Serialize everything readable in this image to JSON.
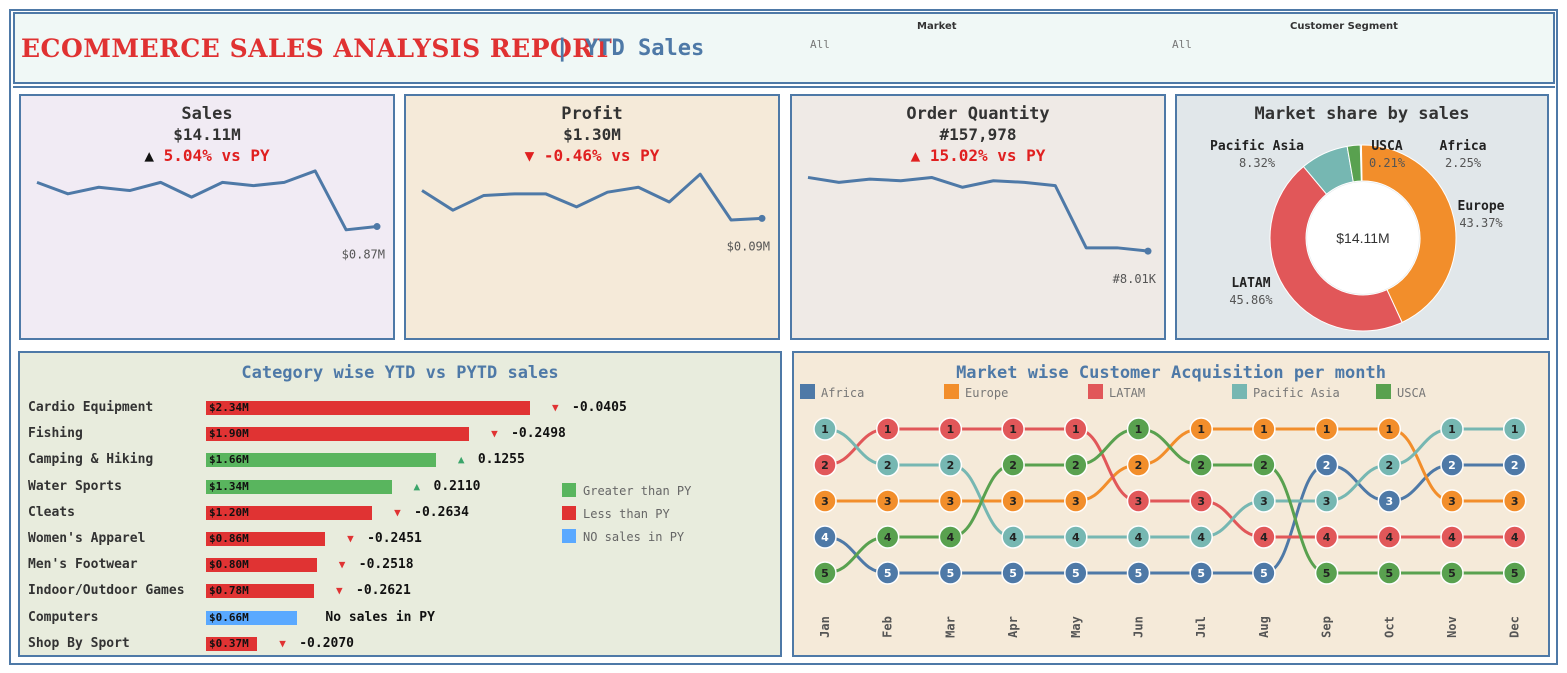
{
  "header": {
    "title": "ECOMMERCE SALES ANALYSIS REPORT",
    "separator": "|",
    "subtitle": "YTD Sales",
    "filters": [
      {
        "label": "Market",
        "value": "All"
      },
      {
        "label": "Customer Segment",
        "value": "All"
      }
    ]
  },
  "kpis": [
    {
      "title": "Sales",
      "value": "$14.11M",
      "arrow": "▲",
      "delta": "5.04% vs PY",
      "last_label": "$0.87M",
      "trend": [
        0.95,
        0.88,
        0.92,
        0.9,
        0.95,
        0.86,
        0.95,
        0.93,
        0.95,
        1.02,
        0.66,
        0.68
      ]
    },
    {
      "title": "Profit",
      "value": "$1.30M",
      "arrow": "▼",
      "delta": "-0.46% vs PY",
      "last_label": "$0.09M",
      "trend": [
        0.9,
        0.78,
        0.87,
        0.88,
        0.88,
        0.8,
        0.89,
        0.92,
        0.83,
        1.0,
        0.72,
        0.73
      ]
    },
    {
      "title": "Order Quantity",
      "value": "#157,978",
      "arrow": "▲",
      "delta": "15.02% vs PY",
      "last_label": "#8.01K",
      "trend": [
        0.98,
        0.95,
        0.97,
        0.96,
        0.98,
        0.92,
        0.96,
        0.95,
        0.93,
        0.55,
        0.55,
        0.53
      ]
    }
  ],
  "market_share": {
    "title": "Market share by sales",
    "center_label": "$14.11M",
    "colors": {
      "USCA": "#4e79a7",
      "Europe": "#f28e2b",
      "LATAM": "#e15759",
      "Pacific Asia": "#76b7b2",
      "Africa": "#59a14f"
    }
  },
  "category": {
    "title": "Category wise YTD vs PYTD sales",
    "legend": [
      {
        "label": "Greater than PY",
        "color": "#59b55e"
      },
      {
        "label": "Less than PY",
        "color": "#e03333"
      },
      {
        "label": "NO sales in PY",
        "color": "#5aa9ff"
      }
    ]
  },
  "acquisition": {
    "title": "Market wise Customer Acquisition per month"
  },
  "chart_data": [
    {
      "type": "pie",
      "title": "Market share by sales",
      "categories": [
        "USCA",
        "Africa",
        "Europe",
        "LATAM",
        "Pacific Asia"
      ],
      "values": [
        0.21,
        2.25,
        43.37,
        45.86,
        8.32
      ],
      "labels": [
        "0.21%",
        "2.25%",
        "43.37%",
        "45.86%",
        "8.32%"
      ],
      "colors": [
        "#4e79a7",
        "#59a14f",
        "#f28e2b",
        "#e15759",
        "#76b7b2"
      ]
    },
    {
      "type": "bar",
      "title": "Category wise YTD vs PYTD sales",
      "categories": [
        "Cardio Equipment",
        "Fishing",
        "Camping & Hiking",
        "Water Sports",
        "Cleats",
        "Women's Apparel",
        "Men's Footwear",
        "Indoor/Outdoor Games",
        "Computers",
        "Shop By Sport"
      ],
      "values": [
        2.34,
        1.9,
        1.66,
        1.34,
        1.2,
        0.86,
        0.8,
        0.78,
        0.66,
        0.37
      ],
      "value_labels": [
        "$2.34M",
        "$1.90M",
        "$1.66M",
        "$1.34M",
        "$1.20M",
        "$0.86M",
        "$0.80M",
        "$0.78M",
        "$0.66M",
        "$0.37M"
      ],
      "delta_labels": [
        "-0.0405",
        "-0.2498",
        "0.1255",
        "0.2110",
        "-0.2634",
        "-0.2451",
        "-0.2518",
        "-0.2621",
        "No sales in PY",
        "-0.2070"
      ],
      "status": [
        "less",
        "less",
        "greater",
        "greater",
        "less",
        "less",
        "less",
        "less",
        "none",
        "less"
      ]
    },
    {
      "type": "line",
      "title": "Market wise Customer Acquisition per month",
      "x": [
        "Jan",
        "Feb",
        "Mar",
        "Apr",
        "May",
        "Jun",
        "Jul",
        "Aug",
        "Sep",
        "Oct",
        "Nov",
        "Dec"
      ],
      "ylim": [
        1,
        5
      ],
      "series": [
        {
          "name": "Africa",
          "color": "#4e79a7",
          "values": [
            4,
            5,
            5,
            5,
            5,
            5,
            5,
            5,
            2,
            3,
            2,
            2
          ]
        },
        {
          "name": "Europe",
          "color": "#f28e2b",
          "values": [
            3,
            3,
            3,
            3,
            3,
            2,
            1,
            1,
            1,
            1,
            3,
            3
          ]
        },
        {
          "name": "LATAM",
          "color": "#e15759",
          "values": [
            2,
            1,
            1,
            1,
            1,
            3,
            3,
            4,
            4,
            4,
            4,
            4
          ]
        },
        {
          "name": "Pacific Asia",
          "color": "#76b7b2",
          "values": [
            1,
            2,
            2,
            4,
            4,
            4,
            4,
            3,
            3,
            2,
            1,
            1
          ]
        },
        {
          "name": "USCA",
          "color": "#59a14f",
          "values": [
            5,
            4,
            4,
            2,
            2,
            1,
            2,
            2,
            5,
            5,
            5,
            5
          ]
        }
      ]
    }
  ]
}
